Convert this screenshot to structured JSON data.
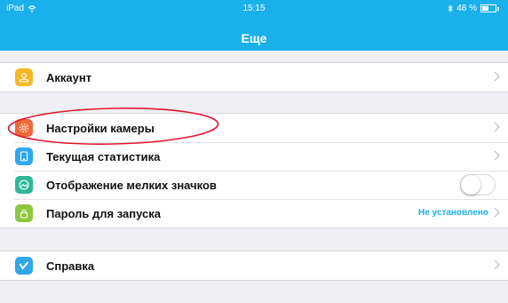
{
  "statusbar": {
    "device": "iPad",
    "time": "15:15",
    "battery_text": "48 %",
    "battery_level": 0.48
  },
  "header": {
    "title": "Еще"
  },
  "sections": [
    {
      "items": [
        {
          "label": "Аккаунт",
          "icon": "person-icon",
          "icon_color": "#f5b728"
        }
      ]
    },
    {
      "items": [
        {
          "label": "Настройки камеры",
          "icon": "gear-icon",
          "icon_color": "#ef6a3a"
        },
        {
          "label": "Текущая статистика",
          "icon": "tablet-icon",
          "icon_color": "#2fa7ea"
        },
        {
          "label": "Отображение мелких значков",
          "icon": "image-icon",
          "icon_color": "#2fb896",
          "toggle": false
        },
        {
          "label": "Пароль для запуска",
          "icon": "lock-icon",
          "icon_color": "#8dc63f",
          "value": "Не установлено"
        }
      ]
    },
    {
      "items": [
        {
          "label": "Справка",
          "icon": "vimeo-icon",
          "icon_color": "#2fa7ea"
        }
      ]
    }
  ],
  "annotation": {
    "shape": "ellipse",
    "color": "#e0182d"
  }
}
